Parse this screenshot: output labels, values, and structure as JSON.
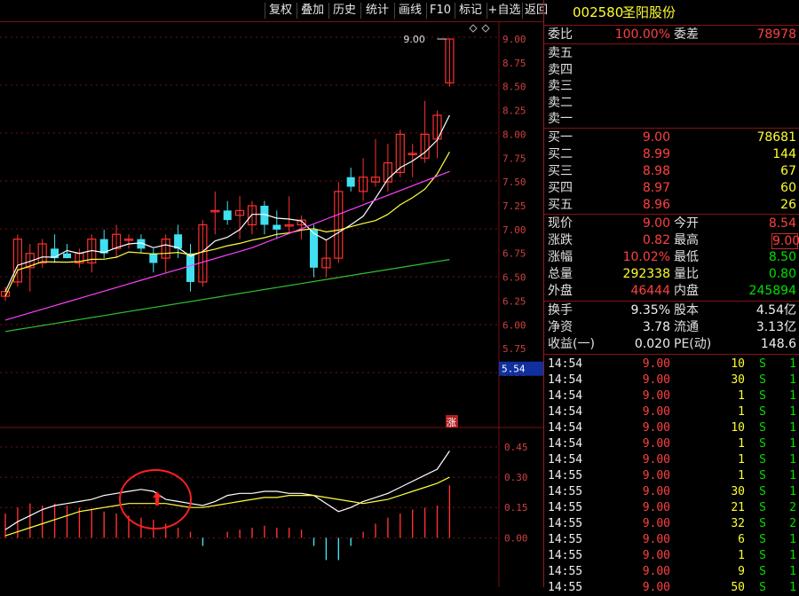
{
  "toolbar": {
    "buttons": [
      "复权",
      "叠加",
      "历史",
      "统计",
      "画线",
      "F10",
      "标记",
      "+自选",
      "返回"
    ]
  },
  "stock": {
    "code": "002580",
    "name": "圣阳股份"
  },
  "order_ratio": {
    "label1": "委比",
    "value1": "100.00%",
    "label2": "委差",
    "value2": "78978"
  },
  "sell_levels": [
    {
      "label": "卖五",
      "price": "",
      "vol": ""
    },
    {
      "label": "卖四",
      "price": "",
      "vol": ""
    },
    {
      "label": "卖三",
      "price": "",
      "vol": ""
    },
    {
      "label": "卖二",
      "price": "",
      "vol": ""
    },
    {
      "label": "卖一",
      "price": "",
      "vol": ""
    }
  ],
  "buy_levels": [
    {
      "label": "买一",
      "price": "9.00",
      "vol": "78681"
    },
    {
      "label": "买二",
      "price": "8.99",
      "vol": "144"
    },
    {
      "label": "买三",
      "price": "8.98",
      "vol": "67"
    },
    {
      "label": "买四",
      "price": "8.97",
      "vol": "60"
    },
    {
      "label": "买五",
      "price": "8.96",
      "vol": "26"
    }
  ],
  "quote": [
    {
      "l1": "现价",
      "v1": "9.00",
      "l2": "今开",
      "v2": "8.54"
    },
    {
      "l1": "涨跌",
      "v1": "0.82",
      "l2": "最高",
      "v2": "9.00"
    },
    {
      "l1": "涨幅",
      "v1": "10.02%",
      "l2": "最低",
      "v2": "8.50"
    },
    {
      "l1": "总量",
      "v1": "292338",
      "l2": "量比",
      "v2": "0.80"
    },
    {
      "l1": "外盘",
      "v1": "46444",
      "l2": "内盘",
      "v2": "245894"
    }
  ],
  "fundamentals": [
    {
      "l1": "换手",
      "v1": "9.35%",
      "l2": "股本",
      "v2": "4.54亿"
    },
    {
      "l1": "净资",
      "v1": "3.78",
      "l2": "流通",
      "v2": "3.13亿"
    },
    {
      "l1": "收益(一)",
      "v1": "0.020",
      "l2": "PE(动)",
      "v2": "148.6"
    }
  ],
  "ticks": [
    {
      "time": "14:54",
      "price": "9.00",
      "vol": "10",
      "side": "S",
      "n": "1"
    },
    {
      "time": "14:54",
      "price": "9.00",
      "vol": "30",
      "side": "S",
      "n": "1"
    },
    {
      "time": "14:54",
      "price": "9.00",
      "vol": "1",
      "side": "S",
      "n": "1"
    },
    {
      "time": "14:54",
      "price": "9.00",
      "vol": "1",
      "side": "S",
      "n": "1"
    },
    {
      "time": "14:54",
      "price": "9.00",
      "vol": "10",
      "side": "S",
      "n": "1"
    },
    {
      "time": "14:54",
      "price": "9.00",
      "vol": "1",
      "side": "S",
      "n": "1"
    },
    {
      "time": "14:54",
      "price": "9.00",
      "vol": "1",
      "side": "S",
      "n": "1"
    },
    {
      "time": "14:55",
      "price": "9.00",
      "vol": "1",
      "side": "S",
      "n": "1"
    },
    {
      "time": "14:55",
      "price": "9.00",
      "vol": "30",
      "side": "S",
      "n": "1"
    },
    {
      "time": "14:55",
      "price": "9.00",
      "vol": "21",
      "side": "S",
      "n": "2"
    },
    {
      "time": "14:55",
      "price": "9.00",
      "vol": "32",
      "side": "S",
      "n": "2"
    },
    {
      "time": "14:55",
      "price": "9.00",
      "vol": "6",
      "side": "S",
      "n": "1"
    },
    {
      "time": "14:55",
      "price": "9.00",
      "vol": "1",
      "side": "S",
      "n": "1"
    },
    {
      "time": "14:55",
      "price": "9.00",
      "vol": "9",
      "side": "S",
      "n": "1"
    },
    {
      "time": "14:55",
      "price": "9.00",
      "vol": "50",
      "side": "S",
      "n": "1"
    }
  ],
  "chart_data": {
    "type": "candlestick",
    "price_axis": {
      "ticks": [
        "9.00",
        "8.75",
        "8.50",
        "8.25",
        "8.00",
        "7.75",
        "7.50",
        "7.25",
        "7.00",
        "6.75",
        "6.50",
        "6.25",
        "6.00",
        "5.75",
        "5.50"
      ],
      "min": 5.5,
      "max": 9.0
    },
    "current_marker": "5.54",
    "high_annotation": "9.00",
    "limit_up_tag": "涨",
    "candles": [
      {
        "o": 6.3,
        "h": 6.4,
        "l": 6.25,
        "c": 6.35
      },
      {
        "o": 6.45,
        "h": 6.95,
        "l": 6.4,
        "c": 6.9
      },
      {
        "o": 6.6,
        "h": 6.85,
        "l": 6.35,
        "c": 6.75
      },
      {
        "o": 6.65,
        "h": 6.9,
        "l": 6.6,
        "c": 6.85
      },
      {
        "o": 6.8,
        "h": 6.95,
        "l": 6.65,
        "c": 6.7
      },
      {
        "o": 6.75,
        "h": 6.85,
        "l": 6.7,
        "c": 6.7
      },
      {
        "o": 6.65,
        "h": 6.8,
        "l": 6.6,
        "c": 6.75
      },
      {
        "o": 6.65,
        "h": 6.95,
        "l": 6.55,
        "c": 6.9
      },
      {
        "o": 6.9,
        "h": 7.0,
        "l": 6.7,
        "c": 6.75
      },
      {
        "o": 6.8,
        "h": 7.05,
        "l": 6.7,
        "c": 6.95
      },
      {
        "o": 6.9,
        "h": 6.95,
        "l": 6.8,
        "c": 6.9
      },
      {
        "o": 6.9,
        "h": 6.95,
        "l": 6.75,
        "c": 6.8
      },
      {
        "o": 6.75,
        "h": 6.8,
        "l": 6.55,
        "c": 6.65
      },
      {
        "o": 6.7,
        "h": 6.95,
        "l": 6.55,
        "c": 6.9
      },
      {
        "o": 6.95,
        "h": 7.05,
        "l": 6.7,
        "c": 6.8
      },
      {
        "o": 6.75,
        "h": 6.85,
        "l": 6.35,
        "c": 6.45
      },
      {
        "o": 6.45,
        "h": 7.1,
        "l": 6.4,
        "c": 7.05
      },
      {
        "o": 7.2,
        "h": 7.4,
        "l": 6.95,
        "c": 7.2
      },
      {
        "o": 7.2,
        "h": 7.3,
        "l": 7.05,
        "c": 7.1
      },
      {
        "o": 7.15,
        "h": 7.35,
        "l": 6.9,
        "c": 7.2
      },
      {
        "o": 7.05,
        "h": 7.3,
        "l": 6.95,
        "c": 7.25
      },
      {
        "o": 7.25,
        "h": 7.3,
        "l": 6.95,
        "c": 7.05
      },
      {
        "o": 7.05,
        "h": 7.2,
        "l": 6.9,
        "c": 7.0
      },
      {
        "o": 7.05,
        "h": 7.35,
        "l": 6.95,
        "c": 7.05
      },
      {
        "o": 7.05,
        "h": 7.15,
        "l": 6.9,
        "c": 7.1
      },
      {
        "o": 7.0,
        "h": 7.05,
        "l": 6.5,
        "c": 6.6
      },
      {
        "o": 6.6,
        "h": 6.9,
        "l": 6.5,
        "c": 6.7
      },
      {
        "o": 6.7,
        "h": 7.5,
        "l": 6.65,
        "c": 7.4
      },
      {
        "o": 7.55,
        "h": 7.65,
        "l": 7.4,
        "c": 7.45
      },
      {
        "o": 7.4,
        "h": 7.75,
        "l": 7.3,
        "c": 7.55
      },
      {
        "o": 7.5,
        "h": 7.95,
        "l": 7.45,
        "c": 7.55
      },
      {
        "o": 7.5,
        "h": 7.9,
        "l": 7.4,
        "c": 7.7
      },
      {
        "o": 7.6,
        "h": 8.05,
        "l": 7.55,
        "c": 8.0
      },
      {
        "o": 7.8,
        "h": 7.9,
        "l": 7.55,
        "c": 7.8
      },
      {
        "o": 7.75,
        "h": 8.35,
        "l": 7.7,
        "c": 8.0
      },
      {
        "o": 7.95,
        "h": 8.25,
        "l": 7.75,
        "c": 8.2
      },
      {
        "o": 8.54,
        "h": 9.0,
        "l": 8.5,
        "c": 9.0
      }
    ],
    "macd_axis": {
      "ticks": [
        "0.45",
        "0.30",
        "0.15",
        "0.00"
      ],
      "min": -0.13,
      "max": 0.52
    },
    "macd_bars": [
      0.12,
      0.15,
      0.17,
      0.16,
      0.17,
      0.16,
      0.15,
      0.14,
      0.13,
      0.12,
      0.11,
      0.1,
      0.09,
      0.07,
      0.05,
      0.03,
      -0.04,
      0.0,
      0.03,
      0.04,
      0.05,
      0.06,
      0.05,
      0.05,
      0.04,
      -0.04,
      -0.11,
      -0.11,
      -0.04,
      0.03,
      0.07,
      0.1,
      0.12,
      0.14,
      0.15,
      0.16,
      0.26
    ],
    "macd_dif": [
      0.04,
      0.08,
      0.11,
      0.14,
      0.16,
      0.17,
      0.18,
      0.19,
      0.21,
      0.22,
      0.23,
      0.24,
      0.23,
      0.19,
      0.18,
      0.17,
      0.16,
      0.18,
      0.21,
      0.22,
      0.22,
      0.23,
      0.23,
      0.22,
      0.22,
      0.21,
      0.17,
      0.13,
      0.15,
      0.18,
      0.2,
      0.22,
      0.25,
      0.28,
      0.31,
      0.34,
      0.43
    ],
    "macd_dea": [
      0.01,
      0.03,
      0.05,
      0.07,
      0.09,
      0.11,
      0.13,
      0.14,
      0.15,
      0.16,
      0.17,
      0.17,
      0.17,
      0.17,
      0.16,
      0.15,
      0.15,
      0.16,
      0.17,
      0.18,
      0.19,
      0.2,
      0.2,
      0.21,
      0.21,
      0.21,
      0.2,
      0.19,
      0.18,
      0.17,
      0.18,
      0.19,
      0.21,
      0.23,
      0.25,
      0.27,
      0.3
    ]
  },
  "colors": {
    "up": "#ff3030",
    "down": "#40e0f0",
    "ma5": "#ffffff",
    "ma10": "#ffff40",
    "ma20": "#ff40ff",
    "ma60": "#30c030",
    "grid": "#7a1010"
  }
}
